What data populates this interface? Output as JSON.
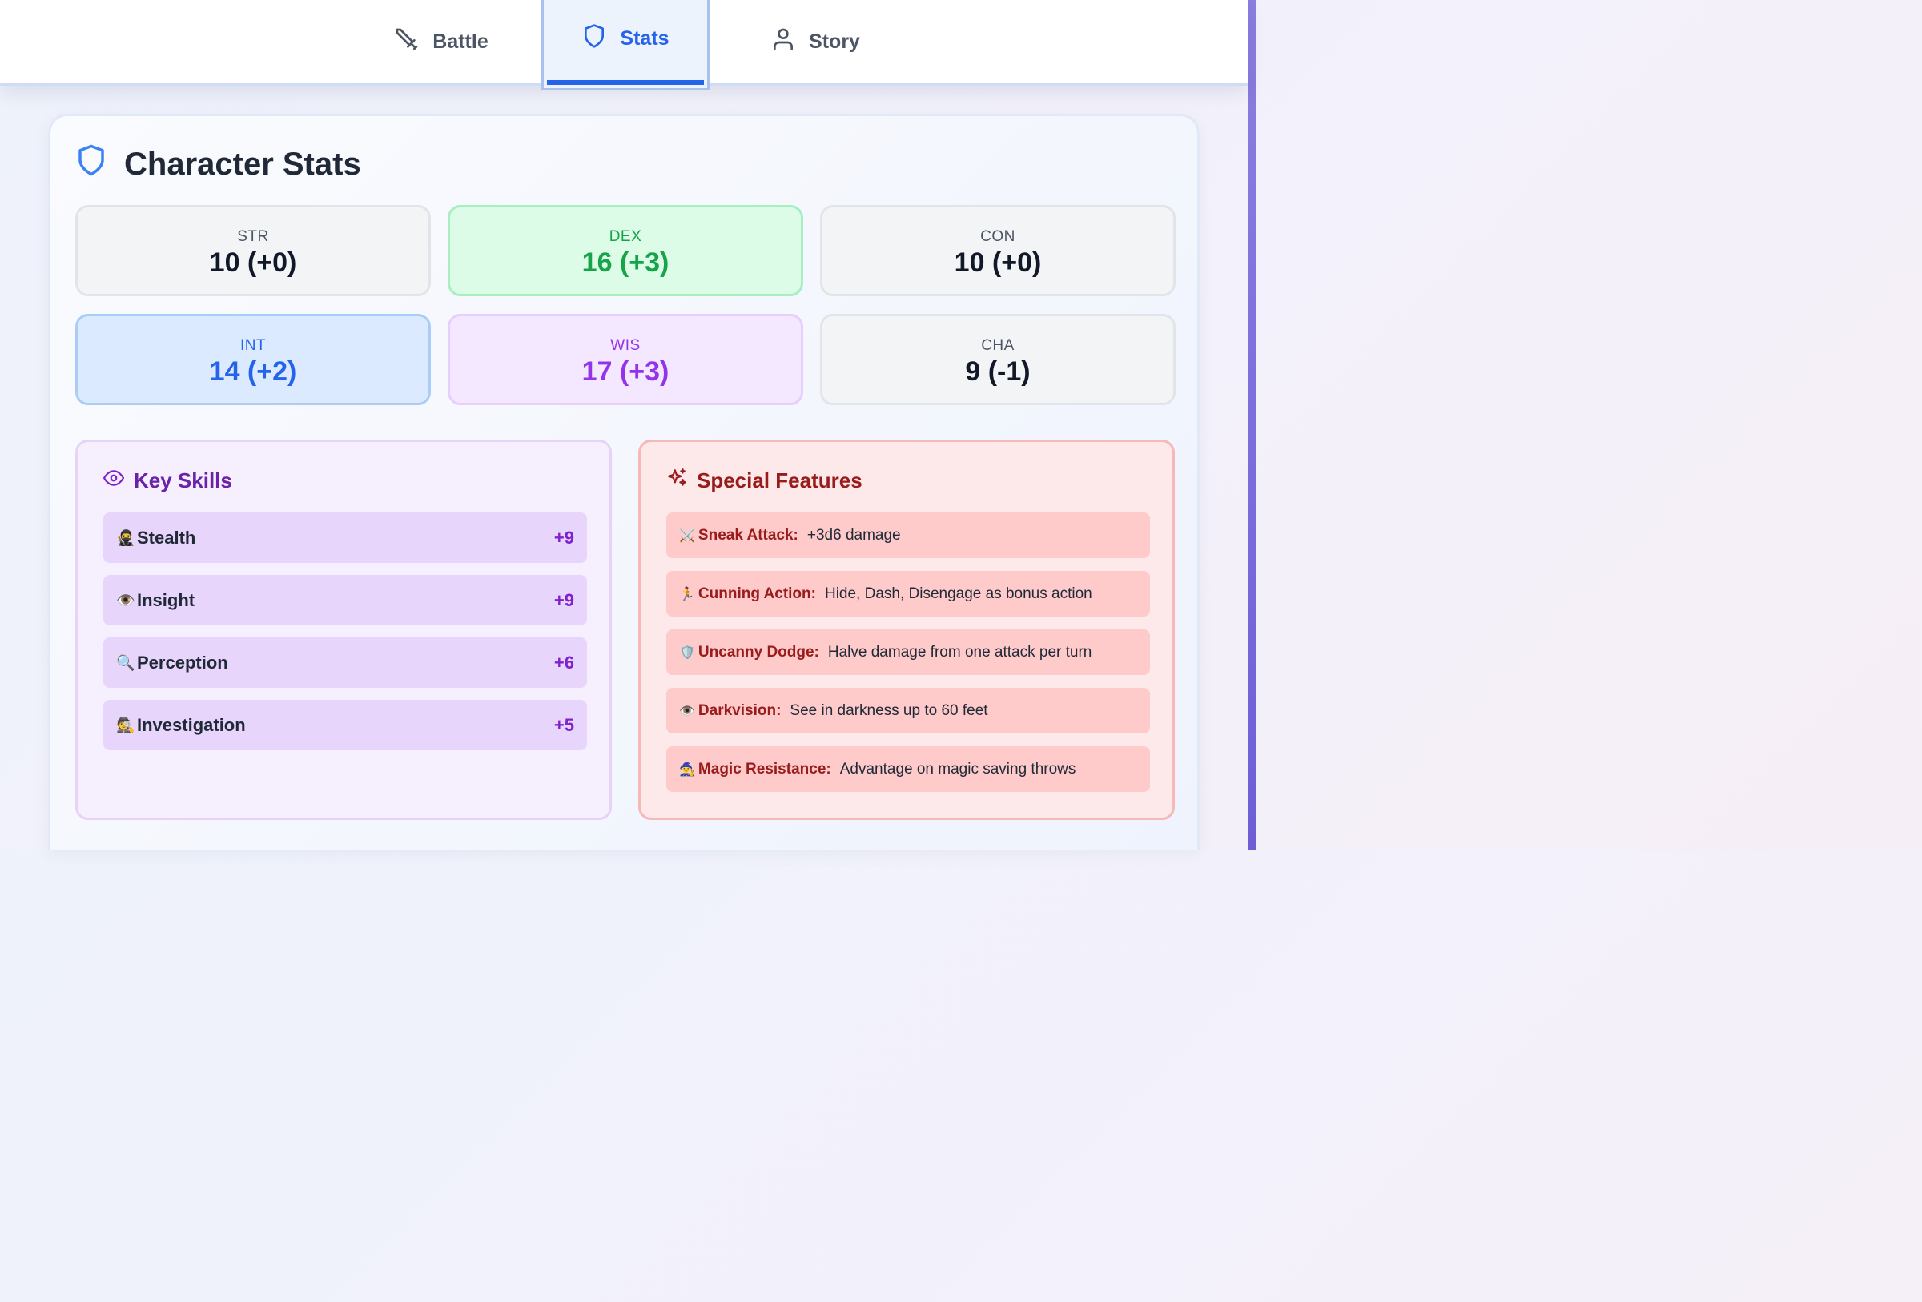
{
  "tabs": {
    "battle": "Battle",
    "stats": "Stats",
    "story": "Story"
  },
  "active_tab": "Stats",
  "card": {
    "title": "Character Stats"
  },
  "stats": [
    {
      "label": "STR",
      "value": "10 (+0)",
      "style": "neutral"
    },
    {
      "label": "DEX",
      "value": "16 (+3)",
      "style": "green"
    },
    {
      "label": "CON",
      "value": "10 (+0)",
      "style": "neutral"
    },
    {
      "label": "INT",
      "value": "14 (+2)",
      "style": "blue"
    },
    {
      "label": "WIS",
      "value": "17 (+3)",
      "style": "purple"
    },
    {
      "label": "CHA",
      "value": "9 (-1)",
      "style": "neutral"
    }
  ],
  "skills": {
    "title": "Key Skills",
    "icon": "eye-icon",
    "items": [
      {
        "emoji": "🥷",
        "name": "Stealth",
        "bonus": "+9"
      },
      {
        "emoji": "👁️",
        "name": "Insight",
        "bonus": "+9"
      },
      {
        "emoji": "🔍",
        "name": "Perception",
        "bonus": "+6"
      },
      {
        "emoji": "🕵️",
        "name": "Investigation",
        "bonus": "+5"
      }
    ]
  },
  "features": {
    "title": "Special Features",
    "icon": "sparkles-icon",
    "items": [
      {
        "emoji": "⚔️",
        "name": "Sneak Attack:",
        "desc": "+3d6 damage"
      },
      {
        "emoji": "🏃",
        "name": "Cunning Action:",
        "desc": "Hide, Dash, Disengage as bonus action"
      },
      {
        "emoji": "🛡️",
        "name": "Uncanny Dodge:",
        "desc": "Halve damage from one attack per turn"
      },
      {
        "emoji": "👁️",
        "name": "Darkvision:",
        "desc": "See in darkness up to 60 feet"
      },
      {
        "emoji": "🧙",
        "name": "Magic Resistance:",
        "desc": "Advantage on magic saving throws"
      }
    ]
  },
  "colors": {
    "accent": "#2563eb",
    "stat_green": "#16a34a",
    "stat_purple": "#9333ea",
    "skills_title": "#6b21a8",
    "features_title": "#991b1b"
  }
}
